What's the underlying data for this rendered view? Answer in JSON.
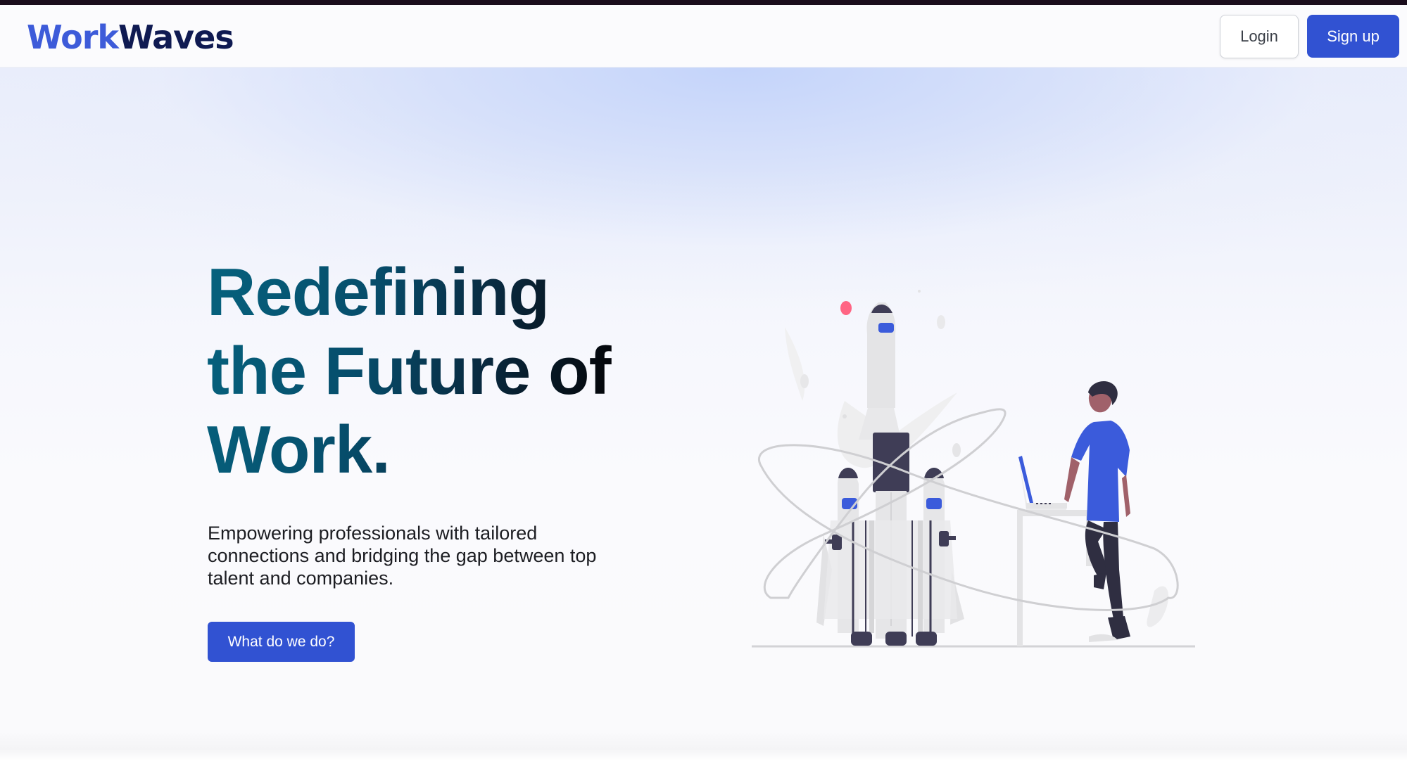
{
  "header": {
    "logo_part1": "Work",
    "logo_part2": "Waves",
    "login_label": "Login",
    "signup_label": "Sign up"
  },
  "hero": {
    "headline": "Redefining the Future of Work.",
    "subtext": "Empowering professionals with tailored connections and bridging the gap between top talent and companies.",
    "cta_label": "What do we do?"
  },
  "colors": {
    "brand_blue": "#3152d2",
    "logo_dark": "#0f1a52",
    "headline_teal": "#06627e"
  },
  "illustration": {
    "icon": "rocket-launch-person-laptop-illustration"
  }
}
